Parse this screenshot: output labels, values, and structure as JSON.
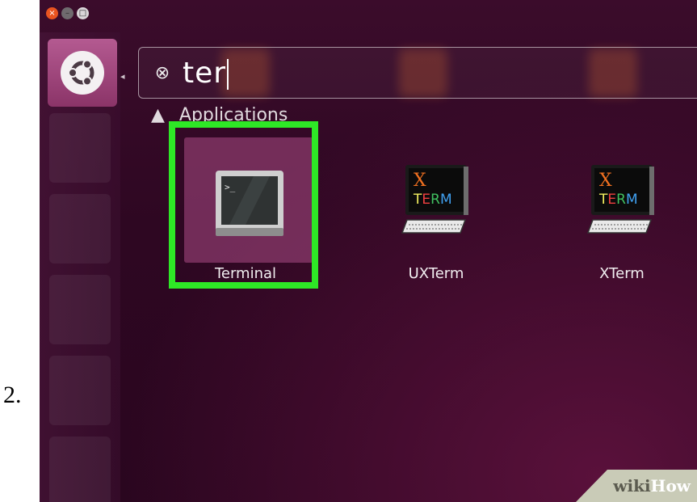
{
  "step_number": "2.",
  "window_controls": {
    "close": "×",
    "minimize": "–",
    "maximize": "□"
  },
  "search": {
    "clear_icon": "⊗",
    "query": "ter"
  },
  "section": {
    "arrow": "▲",
    "label": "Applications"
  },
  "apps": [
    {
      "label": "Terminal",
      "icon": "terminal-icon",
      "selected": true
    },
    {
      "label": "UXTerm",
      "icon": "xterm-monitor-icon"
    },
    {
      "label": "XTerm",
      "icon": "xterm-monitor-icon"
    }
  ],
  "launcher_arrow": "◂",
  "watermark": {
    "part1": "wiki",
    "part2": "How"
  },
  "colors": {
    "highlight": "#2ee826",
    "ubuntu_button": "#9d4479",
    "close_button": "#e95420"
  }
}
